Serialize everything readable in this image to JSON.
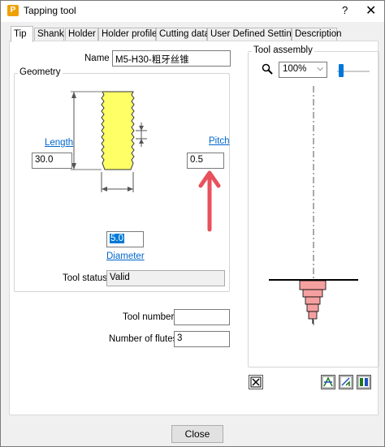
{
  "window": {
    "title": "Tapping tool",
    "icon_letter": "P",
    "help": "?",
    "close": "✕"
  },
  "tabs": [
    {
      "label": "Tip"
    },
    {
      "label": "Shank"
    },
    {
      "label": "Holder"
    },
    {
      "label": "Holder profile"
    },
    {
      "label": "Cutting data"
    },
    {
      "label": "User Defined Settings"
    },
    {
      "label": "Description"
    }
  ],
  "tip": {
    "name_label": "Name",
    "name_value": "M5-H30-粗牙丝锥",
    "geometry_title": "Geometry",
    "length_label": "Length",
    "length_value": "30.0",
    "pitch_label": "Pitch",
    "pitch_value": "0.5",
    "diameter_label": "Diameter",
    "diameter_value": "5.0",
    "tool_status_label": "Tool status",
    "tool_status_value": "Valid",
    "tool_number_label": "Tool number",
    "tool_number_value": "",
    "flutes_label": "Number of flutes",
    "flutes_value": "3"
  },
  "assembly": {
    "title": "Tool assembly",
    "zoom_value": "100%",
    "zoom_slider_level": 0.0
  },
  "footer": {
    "close_label": "Close"
  },
  "colors": {
    "tap_fill": "#ffff66",
    "tool_fill": "#f5a0a0",
    "arrow": "#e8505b",
    "link": "#0066cc"
  }
}
